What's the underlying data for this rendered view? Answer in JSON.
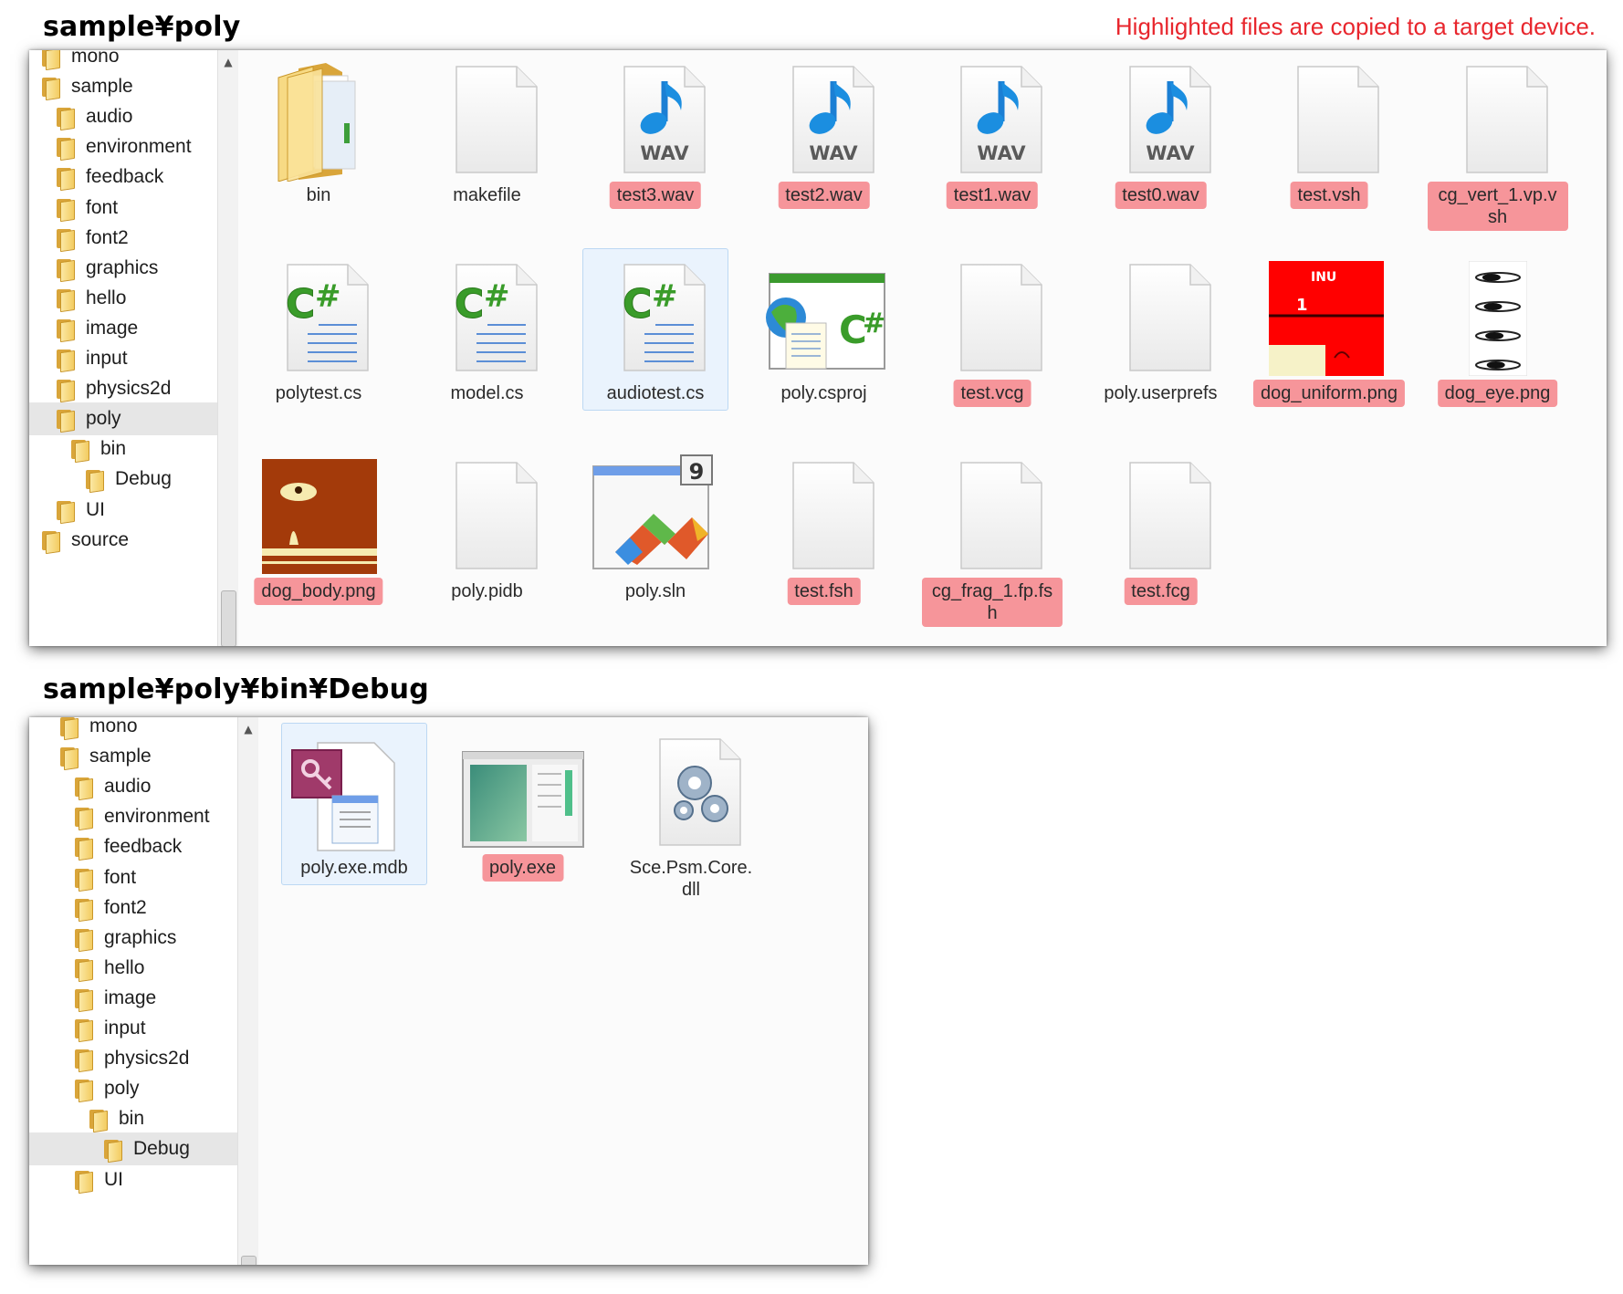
{
  "heading_top": "sample¥poly",
  "heading_bottom": "sample¥poly¥bin¥Debug",
  "note": "Highlighted files are copied to a  target device.",
  "colors": {
    "highlight": "#f6959a",
    "note": "#e8262d",
    "selection": "#eaf3fd"
  },
  "top_window": {
    "tree": [
      {
        "label": "mono",
        "depth": 0
      },
      {
        "label": "sample",
        "depth": 0
      },
      {
        "label": "audio",
        "depth": 1
      },
      {
        "label": "environment",
        "depth": 1
      },
      {
        "label": "feedback",
        "depth": 1
      },
      {
        "label": "font",
        "depth": 1
      },
      {
        "label": "font2",
        "depth": 1
      },
      {
        "label": "graphics",
        "depth": 1
      },
      {
        "label": "hello",
        "depth": 1
      },
      {
        "label": "image",
        "depth": 1
      },
      {
        "label": "input",
        "depth": 1
      },
      {
        "label": "physics2d",
        "depth": 1
      },
      {
        "label": "poly",
        "depth": 1,
        "selected": true
      },
      {
        "label": "bin",
        "depth": 2
      },
      {
        "label": "Debug",
        "depth": 3
      },
      {
        "label": "UI",
        "depth": 1
      },
      {
        "label": "source",
        "depth": 0
      }
    ],
    "files": [
      {
        "name": "bin",
        "icon": "folder-icon",
        "highlighted": false
      },
      {
        "name": "makefile",
        "icon": "blank-file-icon",
        "highlighted": false
      },
      {
        "name": "test3.wav",
        "icon": "wav-file-icon",
        "highlighted": true
      },
      {
        "name": "test2.wav",
        "icon": "wav-file-icon",
        "highlighted": true
      },
      {
        "name": "test1.wav",
        "icon": "wav-file-icon",
        "highlighted": true
      },
      {
        "name": "test0.wav",
        "icon": "wav-file-icon",
        "highlighted": true
      },
      {
        "name": "test.vsh",
        "icon": "blank-file-icon",
        "highlighted": true
      },
      {
        "name": "cg_vert_1.vp.vsh",
        "icon": "blank-file-icon",
        "highlighted": true
      },
      {
        "name": "polytest.cs",
        "icon": "csharp-file-icon",
        "highlighted": false
      },
      {
        "name": "model.cs",
        "icon": "csharp-file-icon",
        "highlighted": false
      },
      {
        "name": "audiotest.cs",
        "icon": "csharp-file-icon",
        "highlighted": false,
        "selected": true
      },
      {
        "name": "poly.csproj",
        "icon": "csproj-file-icon",
        "highlighted": false
      },
      {
        "name": "test.vcg",
        "icon": "blank-file-icon",
        "highlighted": true
      },
      {
        "name": "poly.userprefs",
        "icon": "blank-file-icon",
        "highlighted": false
      },
      {
        "name": "dog_uniform.png",
        "icon": "dog-uniform-thumbnail",
        "highlighted": true
      },
      {
        "name": "dog_eye.png",
        "icon": "dog-eye-thumbnail",
        "highlighted": true
      },
      {
        "name": "dog_body.png",
        "icon": "dog-body-thumbnail",
        "highlighted": true
      },
      {
        "name": "poly.pidb",
        "icon": "blank-file-icon",
        "highlighted": false
      },
      {
        "name": "poly.sln",
        "icon": "vs-solution-icon",
        "highlighted": false,
        "badge": "9"
      },
      {
        "name": "test.fsh",
        "icon": "blank-file-icon",
        "highlighted": true
      },
      {
        "name": "cg_frag_1.fp.fsh",
        "icon": "blank-file-icon",
        "highlighted": true
      },
      {
        "name": "test.fcg",
        "icon": "blank-file-icon",
        "highlighted": true
      }
    ],
    "wav_text": "WAV",
    "thumb_text": {
      "inu": "INU",
      "num": "1"
    }
  },
  "bottom_window": {
    "tree": [
      {
        "label": "mono",
        "depth": 0
      },
      {
        "label": "sample",
        "depth": 0
      },
      {
        "label": "audio",
        "depth": 1
      },
      {
        "label": "environment",
        "depth": 1
      },
      {
        "label": "feedback",
        "depth": 1
      },
      {
        "label": "font",
        "depth": 1
      },
      {
        "label": "font2",
        "depth": 1
      },
      {
        "label": "graphics",
        "depth": 1
      },
      {
        "label": "hello",
        "depth": 1
      },
      {
        "label": "image",
        "depth": 1
      },
      {
        "label": "input",
        "depth": 1
      },
      {
        "label": "physics2d",
        "depth": 1
      },
      {
        "label": "poly",
        "depth": 1
      },
      {
        "label": "bin",
        "depth": 2
      },
      {
        "label": "Debug",
        "depth": 3,
        "selected": true
      },
      {
        "label": "UI",
        "depth": 1
      }
    ],
    "files": [
      {
        "name": "poly.exe.mdb",
        "icon": "mdb-file-icon",
        "highlighted": false,
        "selected": true
      },
      {
        "name": "poly.exe",
        "icon": "exe-window-icon",
        "highlighted": true
      },
      {
        "name": "Sce.Psm.Core.dll",
        "icon": "dll-gears-icon",
        "highlighted": false
      }
    ]
  }
}
